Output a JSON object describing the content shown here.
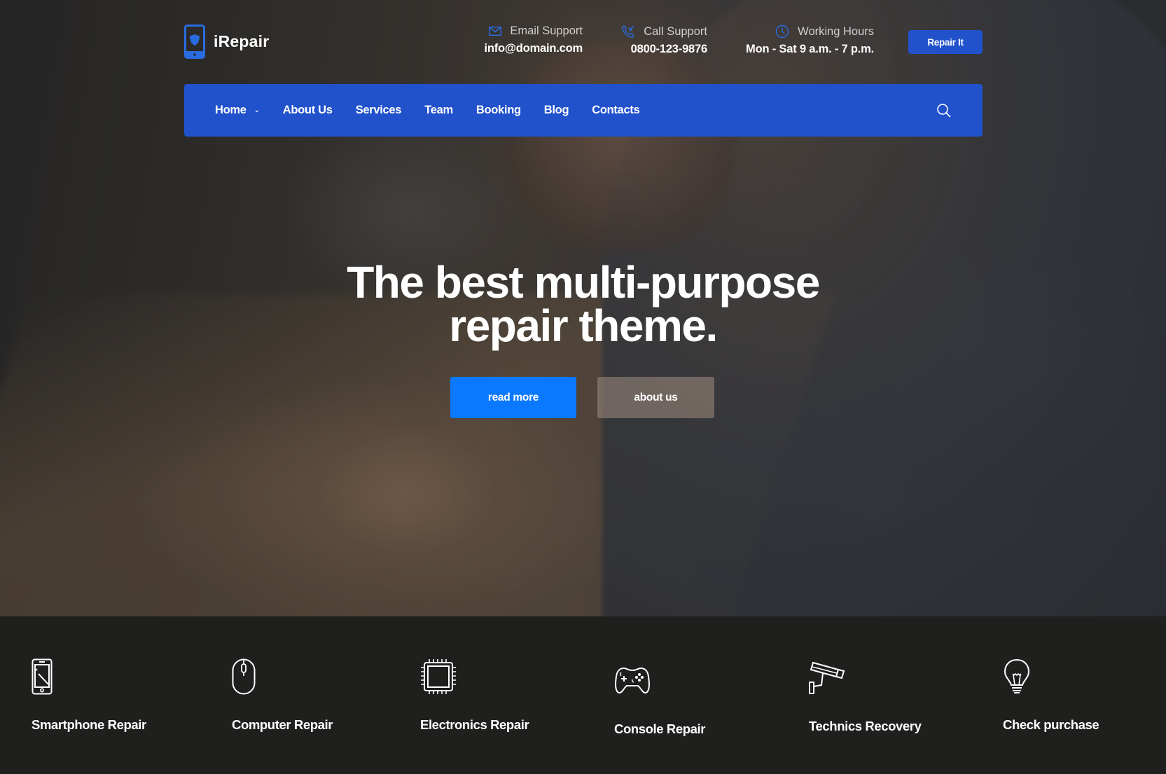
{
  "brand": {
    "name": "iRepair",
    "icon": "phone-shield-icon"
  },
  "colors": {
    "brand_blue": "#2152cc",
    "accent_blue": "#0b79ff",
    "icon_blue": "#2a6be0",
    "dark_bg": "#1f1f1e"
  },
  "contacts": [
    {
      "icon": "envelope-icon",
      "title": "Email Support",
      "value": "info@domain.com"
    },
    {
      "icon": "phone-call-icon",
      "title": "Call Support",
      "value": "0800-123-9876"
    },
    {
      "icon": "clock-icon",
      "title": "Working Hours",
      "value": "Mon - Sat 9 a.m. - 7 p.m."
    }
  ],
  "header_button": "Repair It",
  "nav": {
    "items": [
      {
        "label": "Home",
        "has_dropdown": true
      },
      {
        "label": "About Us"
      },
      {
        "label": "Services"
      },
      {
        "label": "Team"
      },
      {
        "label": "Booking"
      },
      {
        "label": "Blog"
      },
      {
        "label": "Contacts"
      }
    ],
    "search_icon": "search-icon"
  },
  "hero": {
    "title_line1": "The best multi-purpose",
    "title_line2": "repair theme.",
    "primary_button": "read more",
    "secondary_button": "about us"
  },
  "features": [
    {
      "icon": "smartphone-icon",
      "label": "Smartphone Repair"
    },
    {
      "icon": "mouse-icon",
      "label": "Computer Repair"
    },
    {
      "icon": "chip-icon",
      "label": "Electronics Repair"
    },
    {
      "icon": "gamepad-icon",
      "label": "Console Repair"
    },
    {
      "icon": "camera-icon",
      "label": "Technics Recovery"
    },
    {
      "icon": "lightbulb-icon",
      "label": "Check purchase"
    }
  ]
}
